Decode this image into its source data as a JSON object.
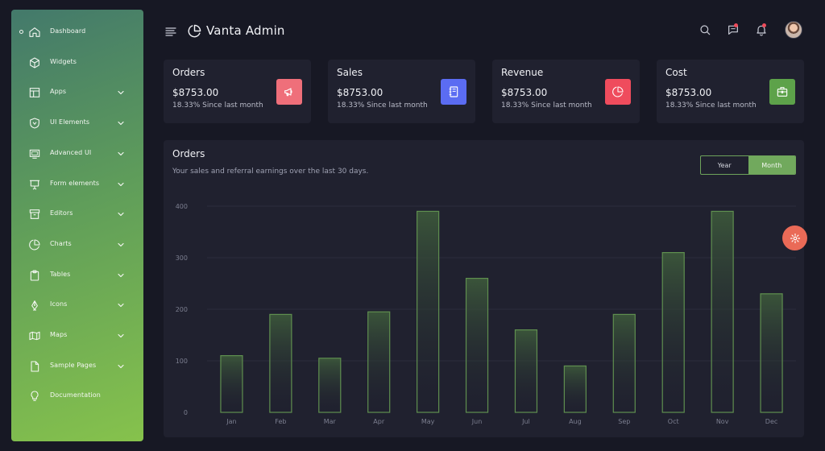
{
  "app": {
    "title": "Vanta Admin"
  },
  "sidebar": {
    "items": [
      {
        "label": "Dashboard",
        "icon": "home-icon",
        "has_chevron": false,
        "active": true
      },
      {
        "label": "Widgets",
        "icon": "cube-icon",
        "has_chevron": false
      },
      {
        "label": "Apps",
        "icon": "layout-icon",
        "has_chevron": true
      },
      {
        "label": "UI Elements",
        "icon": "shield-icon",
        "has_chevron": true
      },
      {
        "label": "Advanced UI",
        "icon": "monitor-icon",
        "has_chevron": true
      },
      {
        "label": "Form elements",
        "icon": "presentation-icon",
        "has_chevron": true
      },
      {
        "label": "Editors",
        "icon": "archive-icon",
        "has_chevron": true
      },
      {
        "label": "Charts",
        "icon": "pie-chart-icon",
        "has_chevron": true
      },
      {
        "label": "Tables",
        "icon": "clipboard-icon",
        "has_chevron": true
      },
      {
        "label": "Icons",
        "icon": "pen-tool-icon",
        "has_chevron": true
      },
      {
        "label": "Maps",
        "icon": "map-icon",
        "has_chevron": true
      },
      {
        "label": "Sample Pages",
        "icon": "file-icon",
        "has_chevron": true
      },
      {
        "label": "Documentation",
        "icon": "lightbulb-icon",
        "has_chevron": false
      }
    ]
  },
  "header": {
    "menu_icon": "hamburger-icon",
    "brand_icon": "pie-chart-icon",
    "actions": [
      "search-icon",
      "message-icon",
      "bell-icon"
    ],
    "avatar": "user-avatar"
  },
  "cards": [
    {
      "title": "Orders",
      "value": "$8753.00",
      "sub": "18.33% Since last month",
      "icon": "megaphone-icon",
      "color": "#ef6f7a"
    },
    {
      "title": "Sales",
      "value": "$8753.00",
      "sub": "18.33% Since last month",
      "icon": "notebook-icon",
      "color": "#5b6cf2"
    },
    {
      "title": "Revenue",
      "value": "$8753.00",
      "sub": "18.33% Since last month",
      "icon": "pie-chart-icon",
      "color": "#ef4c5d"
    },
    {
      "title": "Cost",
      "value": "$8753.00",
      "sub": "18.33% Since last month",
      "icon": "briefcase-icon",
      "color": "#5da24a"
    }
  ],
  "chart_panel": {
    "title": "Orders",
    "subtitle": "Your sales and referral earnings over the last 30 days.",
    "toggle": {
      "year": "Year",
      "month": "Month",
      "active": "Month"
    }
  },
  "chart_data": {
    "type": "bar",
    "categories": [
      "Jan",
      "Feb",
      "Mar",
      "Apr",
      "May",
      "Jun",
      "Jul",
      "Aug",
      "Sep",
      "Oct",
      "Nov",
      "Dec"
    ],
    "values": [
      110,
      190,
      105,
      195,
      390,
      260,
      160,
      90,
      190,
      310,
      390,
      230
    ],
    "ylim": [
      0,
      400
    ],
    "yticks": [
      0,
      100,
      200,
      300,
      400
    ],
    "grid": true,
    "colors": {
      "bar_stroke": "#5f8f4f",
      "bar_fill_top": "#3d5a3b",
      "grid": "#2b2d3c",
      "tick": "#7c7f90"
    }
  },
  "fab": {
    "icon": "settings-icon",
    "color": "#ea6a57"
  }
}
